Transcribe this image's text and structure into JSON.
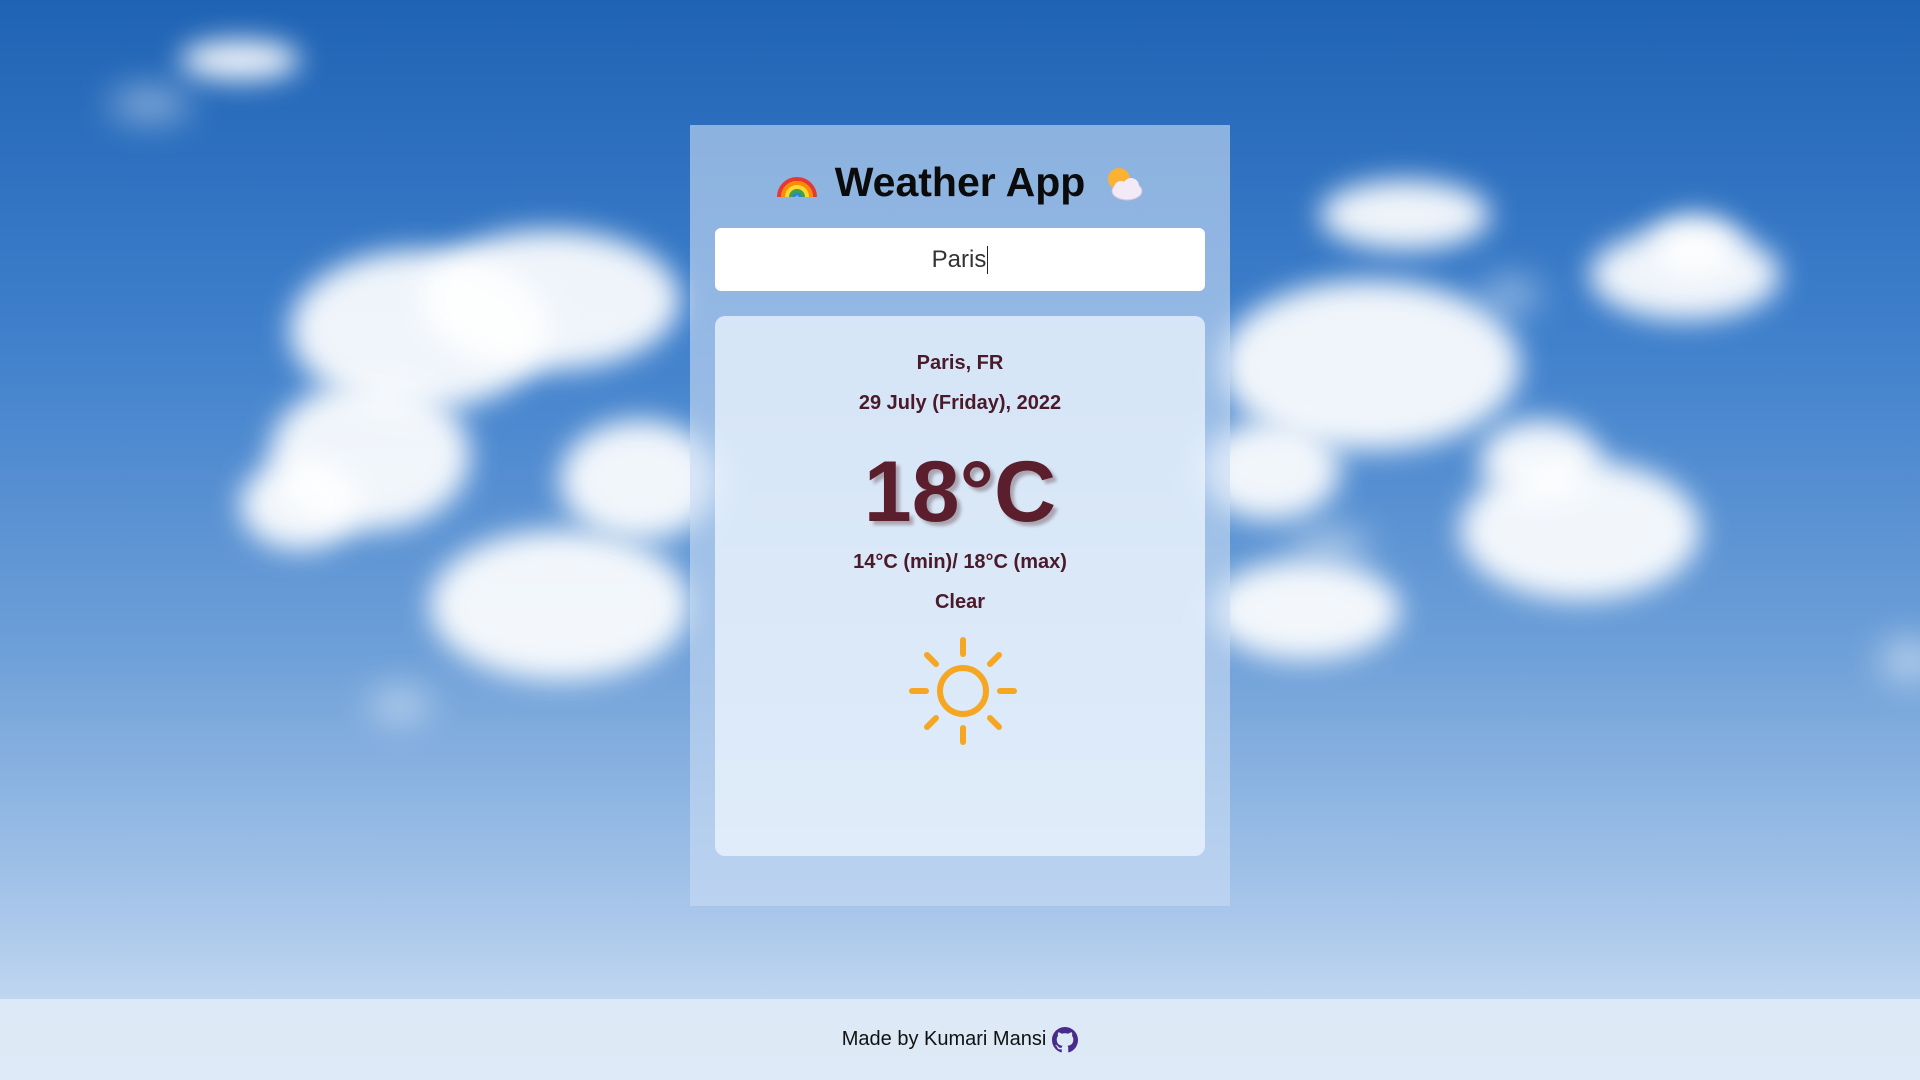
{
  "app": {
    "title": "Weather App",
    "title_left_icon": "rainbow-icon",
    "title_right_icon": "sun-behind-cloud-icon"
  },
  "search": {
    "value": "Paris"
  },
  "weather": {
    "location": "Paris, FR",
    "date": "29 July (Friday), 2022",
    "temperature": "18°C",
    "min_max": "14°C (min)/ 18°C (max)",
    "condition": "Clear",
    "condition_icon": "sun-icon",
    "colors": {
      "text": "#4b1a2a",
      "sun": "#f5a623"
    }
  },
  "footer": {
    "text": "Made by Kumari Mansi",
    "icon": "github-icon",
    "icon_color": "#4a2a8a"
  }
}
